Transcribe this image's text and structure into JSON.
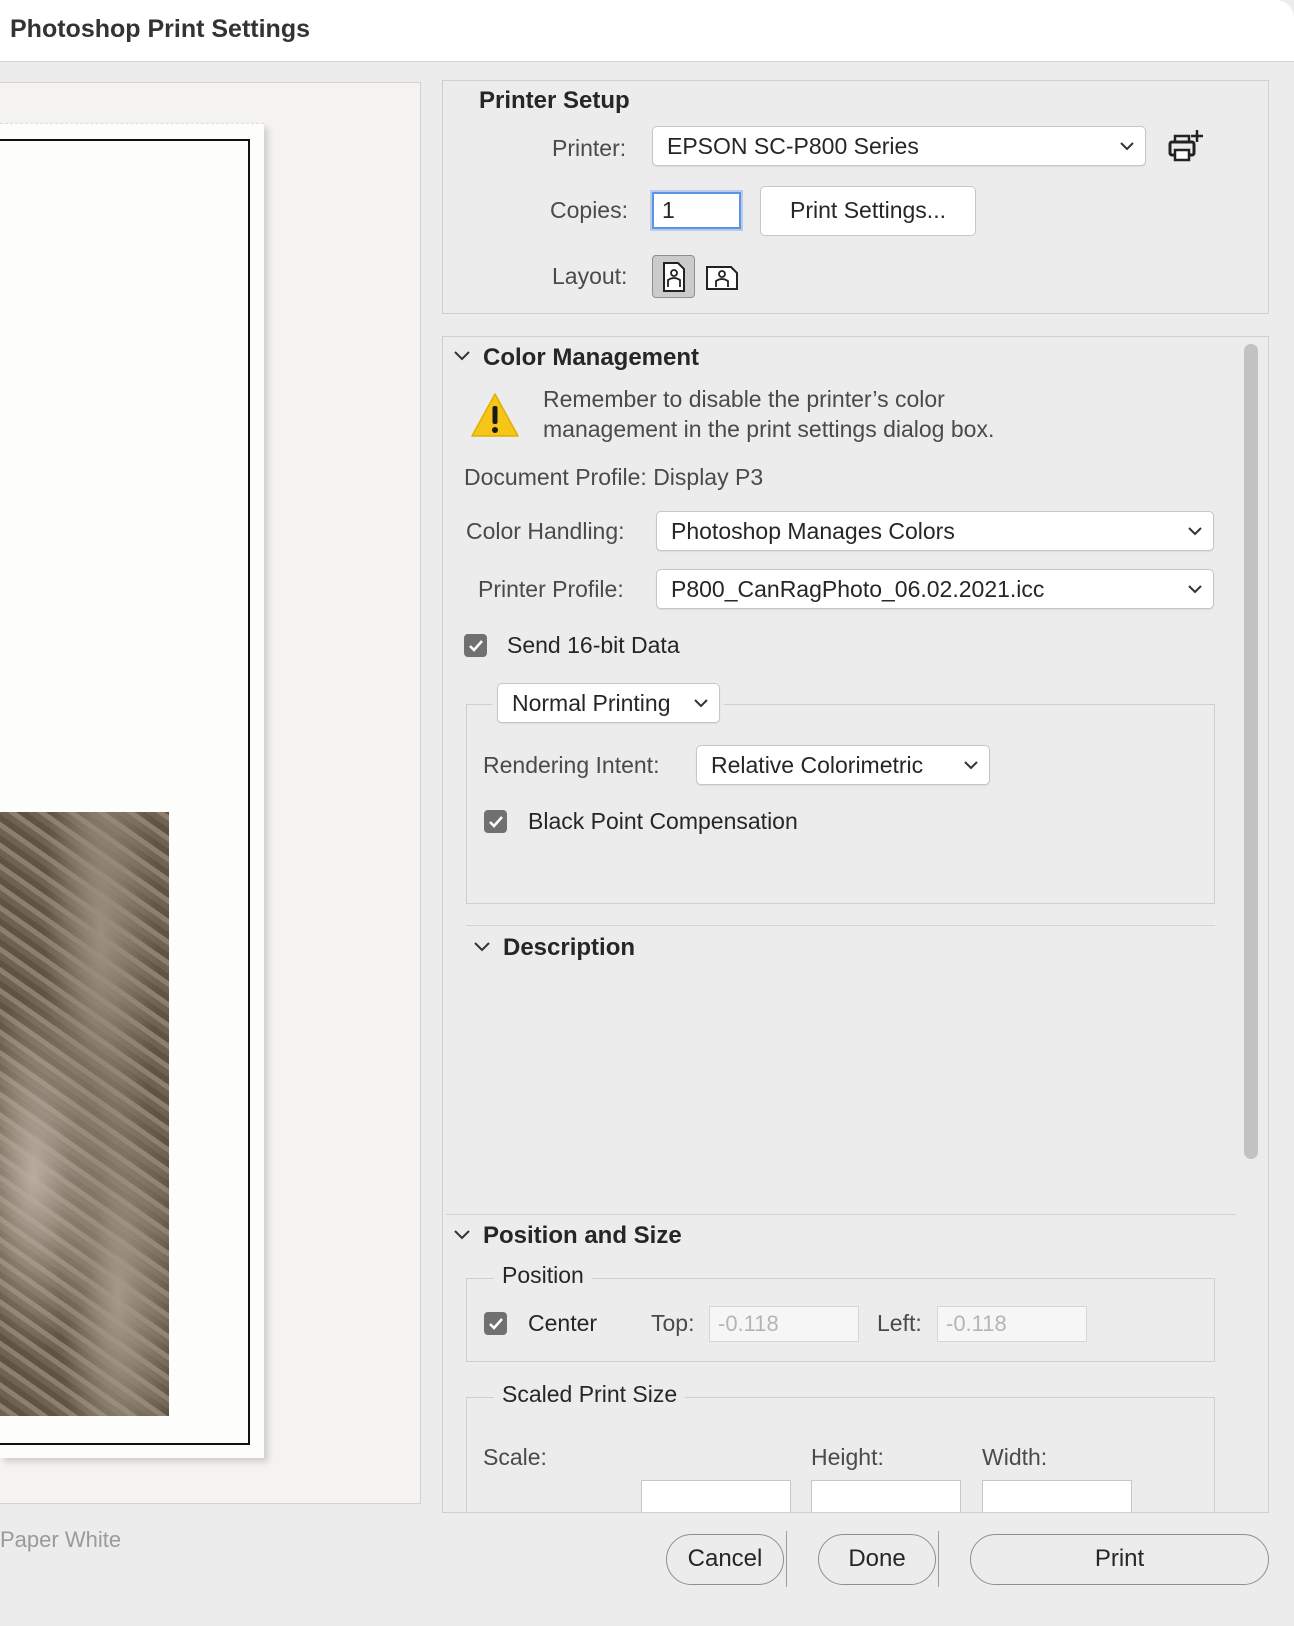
{
  "window": {
    "title": "Photoshop Print Settings"
  },
  "preview": {
    "paper_white_label": "Paper White"
  },
  "printer_setup": {
    "title": "Printer Setup",
    "printer_label": "Printer:",
    "printer_value": "EPSON SC-P800 Series",
    "copies_label": "Copies:",
    "copies_value": "1",
    "print_settings_button": "Print Settings...",
    "layout_label": "Layout:"
  },
  "color_management": {
    "title": "Color Management",
    "warning_line1": "Remember to disable the printer’s color",
    "warning_line2": "management in the print settings dialog box.",
    "document_profile": "Document Profile: Display P3",
    "color_handling_label": "Color Handling:",
    "color_handling_value": "Photoshop Manages Colors",
    "printer_profile_label": "Printer Profile:",
    "printer_profile_value": "P800_CanRagPhoto_06.02.2021.icc",
    "send_16bit_label": "Send 16-bit Data",
    "printing_mode_value": "Normal Printing",
    "rendering_intent_label": "Rendering Intent:",
    "rendering_intent_value": "Relative Colorimetric",
    "black_point_label": "Black Point Compensation"
  },
  "description": {
    "title": "Description"
  },
  "position_and_size": {
    "title": "Position and Size",
    "position_group": "Position",
    "center_label": "Center",
    "top_label": "Top:",
    "top_value": "-0.118",
    "left_label": "Left:",
    "left_value": "-0.118",
    "scaled_group": "Scaled Print Size",
    "scale_label": "Scale:",
    "height_label": "Height:",
    "width_label": "Width:"
  },
  "footer": {
    "cancel": "Cancel",
    "done": "Done",
    "print": "Print"
  },
  "colors": {
    "accent_focus": "#5a93e8",
    "warning_yellow": "#f5c518",
    "checkbox_gray": "#707070"
  },
  "icons": {
    "printer_add": "printer-add-icon",
    "warning": "warning-icon",
    "layout_portrait": "portrait-layout-icon",
    "layout_landscape": "landscape-layout-icon",
    "chevron": "chevron-down-icon",
    "check": "checkmark-icon"
  }
}
